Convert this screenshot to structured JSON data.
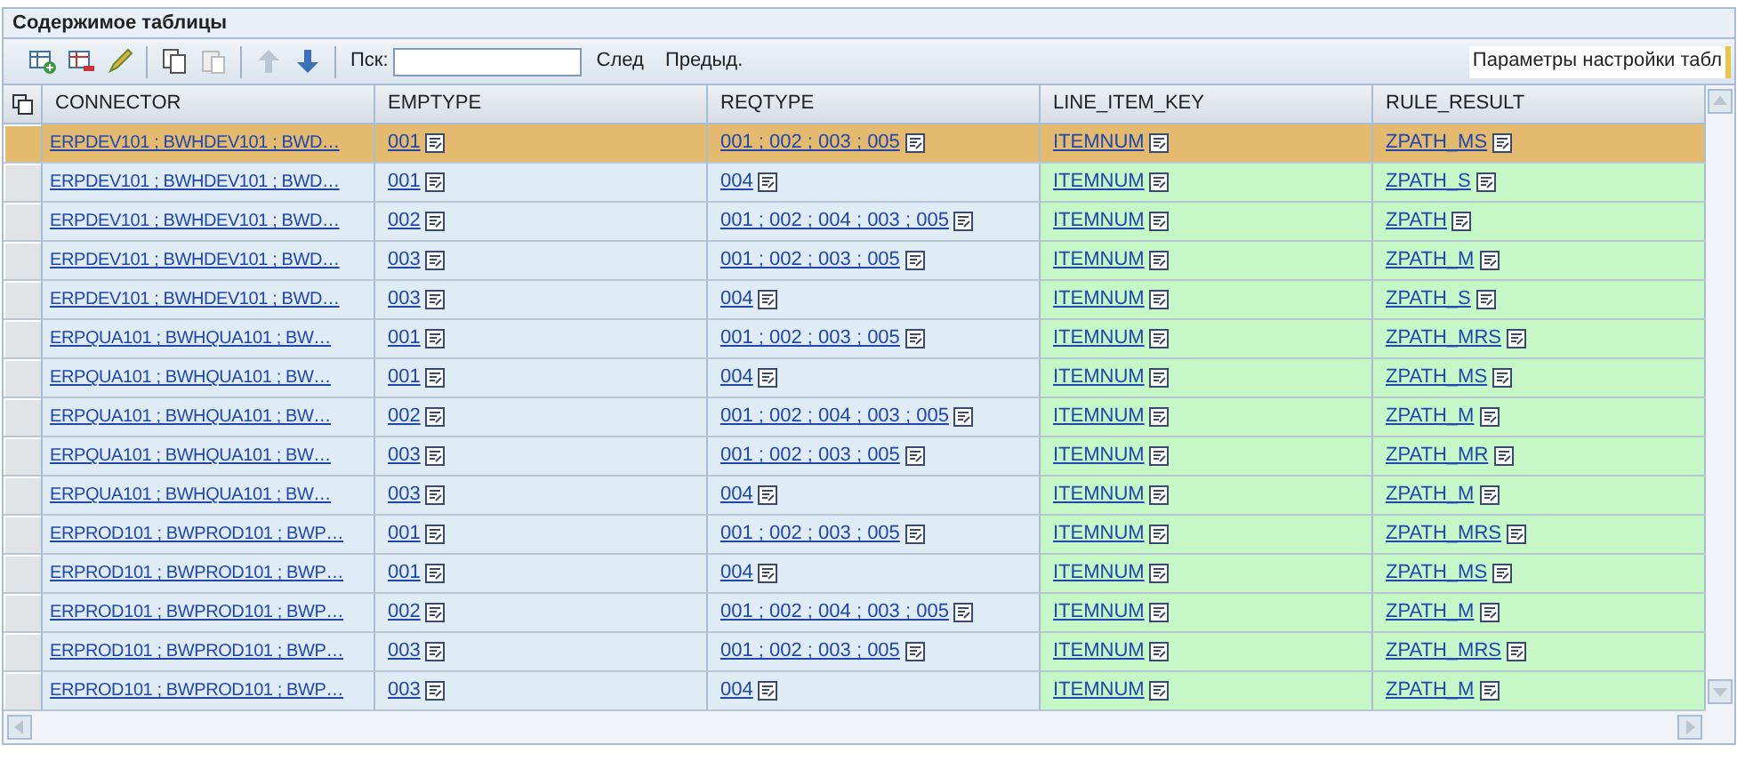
{
  "panel": {
    "title": "Содержимое таблицы"
  },
  "toolbar": {
    "tools": [
      {
        "kind": "insert",
        "disabled": false
      },
      {
        "kind": "delete",
        "disabled": false
      },
      {
        "kind": "edit",
        "disabled": false
      },
      {
        "kind": "copy",
        "disabled": false
      },
      {
        "kind": "paste",
        "disabled": true
      },
      {
        "kind": "up",
        "disabled": true
      },
      {
        "kind": "down",
        "disabled": false
      }
    ],
    "search_label": "Пск:",
    "next": "След",
    "previous": "Предыд.",
    "settings": "Параметры настройки табл"
  },
  "table": {
    "columns": [
      {
        "label": "CONNECTOR",
        "highlighted": false
      },
      {
        "label": "EMPTYPE",
        "highlighted": false
      },
      {
        "label": "REQTYPE",
        "highlighted": false
      },
      {
        "label": "LINE_ITEM_KEY",
        "highlighted": true
      },
      {
        "label": "RULE_RESULT",
        "highlighted": true
      }
    ],
    "rows": [
      {
        "selected": true,
        "cells": [
          "ERPDEV101 ; BWHDEV101 ; BWD…",
          "001",
          "001 ; 002 ; 003 ; 005",
          "ITEMNUM",
          "ZPATH_MS"
        ]
      },
      {
        "selected": false,
        "cells": [
          "ERPDEV101 ; BWHDEV101 ; BWD…",
          "001",
          "004",
          "ITEMNUM",
          "ZPATH_S"
        ]
      },
      {
        "selected": false,
        "cells": [
          "ERPDEV101 ; BWHDEV101 ; BWD…",
          "002",
          "001 ; 002 ; 004 ; 003 ; 005",
          "ITEMNUM",
          "ZPATH"
        ]
      },
      {
        "selected": false,
        "cells": [
          "ERPDEV101 ; BWHDEV101 ; BWD…",
          "003",
          "001 ; 002 ; 003 ; 005",
          "ITEMNUM",
          "ZPATH_M"
        ]
      },
      {
        "selected": false,
        "cells": [
          "ERPDEV101 ; BWHDEV101 ; BWD…",
          "003",
          "004",
          "ITEMNUM",
          "ZPATH_S"
        ]
      },
      {
        "selected": false,
        "cells": [
          "ERPQUA101 ; BWHQUA101 ; BW…",
          "001",
          "001 ; 002 ; 003 ; 005",
          "ITEMNUM",
          "ZPATH_MRS"
        ]
      },
      {
        "selected": false,
        "cells": [
          "ERPQUA101 ; BWHQUA101 ; BW…",
          "001",
          "004",
          "ITEMNUM",
          "ZPATH_MS"
        ]
      },
      {
        "selected": false,
        "cells": [
          "ERPQUA101 ; BWHQUA101 ; BW…",
          "002",
          "001 ; 002 ; 004 ; 003 ; 005",
          "ITEMNUM",
          "ZPATH_M"
        ]
      },
      {
        "selected": false,
        "cells": [
          "ERPQUA101 ; BWHQUA101 ; BW…",
          "003",
          "001 ; 002 ; 003 ; 005",
          "ITEMNUM",
          "ZPATH_MR"
        ]
      },
      {
        "selected": false,
        "cells": [
          "ERPQUA101 ; BWHQUA101 ; BW…",
          "003",
          "004",
          "ITEMNUM",
          "ZPATH_M"
        ]
      },
      {
        "selected": false,
        "cells": [
          "ERPROD101 ; BWPROD101 ; BWP…",
          "001",
          "001 ; 002 ; 003 ; 005",
          "ITEMNUM",
          "ZPATH_MRS"
        ]
      },
      {
        "selected": false,
        "cells": [
          "ERPROD101 ; BWPROD101 ; BWP…",
          "001",
          "004",
          "ITEMNUM",
          "ZPATH_MS"
        ]
      },
      {
        "selected": false,
        "cells": [
          "ERPROD101 ; BWPROD101 ; BWP…",
          "002",
          "001 ; 002 ; 004 ; 003 ; 005",
          "ITEMNUM",
          "ZPATH_M"
        ]
      },
      {
        "selected": false,
        "cells": [
          "ERPROD101 ; BWPROD101 ; BWP…",
          "003",
          "001 ; 002 ; 003 ; 005",
          "ITEMNUM",
          "ZPATH_MRS"
        ]
      },
      {
        "selected": false,
        "cells": [
          "ERPROD101 ; BWPROD101 ; BWP…",
          "003",
          "004",
          "ITEMNUM",
          "ZPATH_M"
        ]
      }
    ]
  }
}
